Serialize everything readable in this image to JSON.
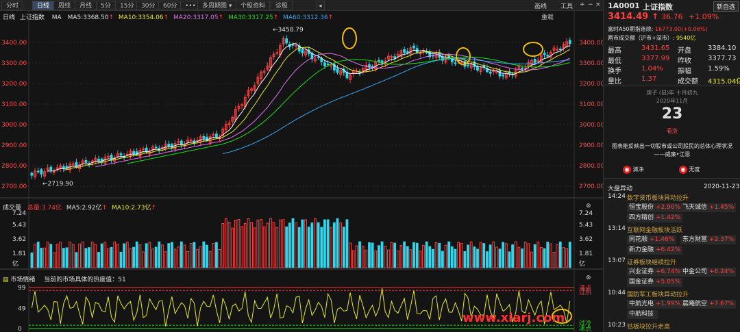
{
  "toolbar": {
    "left_tabs": [
      "分时",
      "日线",
      "周线",
      "月线",
      "5分",
      "15分",
      "30分",
      "60分",
      "•••",
      "多周期图 ▾",
      "个股资料",
      "诊股"
    ],
    "active_tab": "日线",
    "right": [
      "画线",
      "工具",
      "+",
      "−",
      "×"
    ],
    "reset": "重载"
  },
  "main": {
    "period": "日线",
    "name": "上证指数",
    "ma_label": "MA",
    "ma5": "MA5:3368.50",
    "ma10": "MA10:3354.06",
    "ma20": "MA20:3317.05",
    "ma30": "MA30:3317.25",
    "ma60": "MA60:3312.36",
    "high_label": "3458.79",
    "low_label": "2719.90",
    "y_ticks": [
      "3400.00",
      "3300.00",
      "3200.00",
      "3100.00",
      "3000.00",
      "2900.00",
      "2800.00",
      "2700.00"
    ]
  },
  "volume": {
    "title": "成交量",
    "total": "总量:3.74亿",
    "ma5": "MA5:2.92亿",
    "ma10": "MA10:2.73亿",
    "y_ticks": [
      "7.24",
      "5.43",
      "3.62",
      "1.81",
      "亿"
    ]
  },
  "sentiment": {
    "title": "市场情绪",
    "subtitle": "当前的市场具体的热度值：51",
    "y_ticks": [
      "99",
      "49",
      "0"
    ],
    "right_labels": [
      "沸点",
      "过热",
      "过冷",
      "冰点"
    ]
  },
  "quote": {
    "code": "1A0001",
    "name": "上证指数",
    "button": "新自选",
    "price": "3414.49",
    "arrow": "↑",
    "change": "36.76",
    "pct": "+1.09%",
    "a50_label": "富时A50期指连续:",
    "a50_value": "16773.00(+0.06%)",
    "turnover_label": "两市成交额（沪市+深市）:",
    "turnover_value": "9540亿",
    "stats": [
      {
        "k1": "最高",
        "v1": "3431.65",
        "k2": "开盘",
        "v2": "3384.10"
      },
      {
        "k1": "最低",
        "v1": "3377.99",
        "k2": "昨收",
        "v2": "3377.73"
      },
      {
        "k1": "换手",
        "v1": "1.04%",
        "k2": "振幅",
        "v2": "1.59%"
      },
      {
        "k1": "量比",
        "v1": "1.37",
        "k2": "成交额",
        "v2": "4315.04亿"
      }
    ]
  },
  "calendar": {
    "lunar": "庚子 (鼠)年 十月初九",
    "month": "2020年11月",
    "day": "23",
    "status": "看涨",
    "quote_text": "图表能反映出一切股市或公司股民的总体心理状况",
    "author": "——威廉•江恩",
    "btn1": "清净",
    "btn2": "无度"
  },
  "events": {
    "title": "大盘异动",
    "date": "2020-11-23",
    "items": [
      {
        "time": "14:24",
        "headline": "数字货币板块异动拉升",
        "tags": [
          [
            "恒宝股份",
            "+2.90%"
          ],
          [
            "飞天诚信",
            "+1.45%"
          ],
          [
            "四方精创",
            "+1.42%"
          ]
        ]
      },
      {
        "time": "13:14",
        "headline": "互联网金融板块活跃",
        "tags": [
          [
            "同花顺",
            "+1.46%"
          ],
          [
            "东方财富",
            "+2.37%"
          ],
          [
            "新力金融",
            "+6.42%"
          ]
        ]
      },
      {
        "time": "13:07",
        "headline": "证券板块继续拉升",
        "tags": [
          [
            "兴业证券",
            "+6.74%"
          ],
          [
            "中金公司",
            "+6.24%"
          ],
          [
            "国金证券",
            "+5.05%"
          ]
        ]
      },
      {
        "time": "10:44",
        "headline": "国防军工板块异动拉升",
        "tags": [
          [
            "中航光电",
            "+1.99%"
          ],
          [
            "晨曦航空",
            "+7.67%"
          ],
          [
            "中航科技",
            ""
          ]
        ]
      },
      {
        "time": "10:23",
        "headline": "钴板块拉升走高",
        "tags": []
      }
    ]
  },
  "watermark": "www.xiarj.com",
  "colors": {
    "up": "#ff4040",
    "down": "#31d6ea",
    "ma5": "#ffffff",
    "ma10": "#e8e82a",
    "ma20": "#e46ef2",
    "ma30": "#17e217",
    "ma60": "#3aa6f6"
  }
}
